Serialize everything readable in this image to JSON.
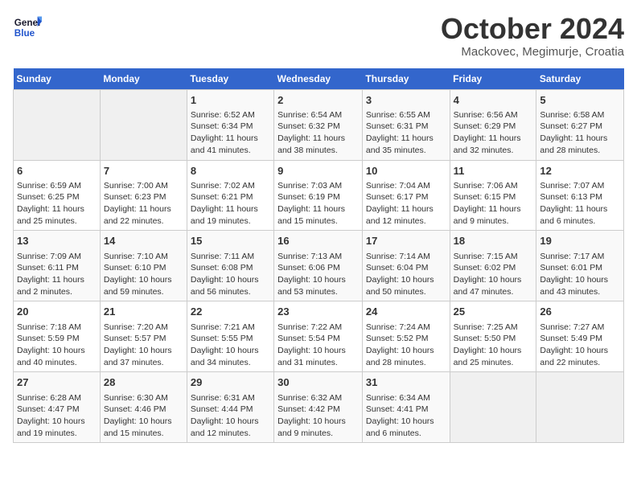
{
  "header": {
    "logo_general": "General",
    "logo_blue": "Blue",
    "month": "October 2024",
    "location": "Mackovec, Megimurje, Croatia"
  },
  "columns": [
    "Sunday",
    "Monday",
    "Tuesday",
    "Wednesday",
    "Thursday",
    "Friday",
    "Saturday"
  ],
  "weeks": [
    [
      {
        "day": "",
        "sunrise": "",
        "sunset": "",
        "daylight": "",
        "empty": true
      },
      {
        "day": "",
        "sunrise": "",
        "sunset": "",
        "daylight": "",
        "empty": true
      },
      {
        "day": "1",
        "sunrise": "Sunrise: 6:52 AM",
        "sunset": "Sunset: 6:34 PM",
        "daylight": "Daylight: 11 hours and 41 minutes."
      },
      {
        "day": "2",
        "sunrise": "Sunrise: 6:54 AM",
        "sunset": "Sunset: 6:32 PM",
        "daylight": "Daylight: 11 hours and 38 minutes."
      },
      {
        "day": "3",
        "sunrise": "Sunrise: 6:55 AM",
        "sunset": "Sunset: 6:31 PM",
        "daylight": "Daylight: 11 hours and 35 minutes."
      },
      {
        "day": "4",
        "sunrise": "Sunrise: 6:56 AM",
        "sunset": "Sunset: 6:29 PM",
        "daylight": "Daylight: 11 hours and 32 minutes."
      },
      {
        "day": "5",
        "sunrise": "Sunrise: 6:58 AM",
        "sunset": "Sunset: 6:27 PM",
        "daylight": "Daylight: 11 hours and 28 minutes."
      }
    ],
    [
      {
        "day": "6",
        "sunrise": "Sunrise: 6:59 AM",
        "sunset": "Sunset: 6:25 PM",
        "daylight": "Daylight: 11 hours and 25 minutes."
      },
      {
        "day": "7",
        "sunrise": "Sunrise: 7:00 AM",
        "sunset": "Sunset: 6:23 PM",
        "daylight": "Daylight: 11 hours and 22 minutes."
      },
      {
        "day": "8",
        "sunrise": "Sunrise: 7:02 AM",
        "sunset": "Sunset: 6:21 PM",
        "daylight": "Daylight: 11 hours and 19 minutes."
      },
      {
        "day": "9",
        "sunrise": "Sunrise: 7:03 AM",
        "sunset": "Sunset: 6:19 PM",
        "daylight": "Daylight: 11 hours and 15 minutes."
      },
      {
        "day": "10",
        "sunrise": "Sunrise: 7:04 AM",
        "sunset": "Sunset: 6:17 PM",
        "daylight": "Daylight: 11 hours and 12 minutes."
      },
      {
        "day": "11",
        "sunrise": "Sunrise: 7:06 AM",
        "sunset": "Sunset: 6:15 PM",
        "daylight": "Daylight: 11 hours and 9 minutes."
      },
      {
        "day": "12",
        "sunrise": "Sunrise: 7:07 AM",
        "sunset": "Sunset: 6:13 PM",
        "daylight": "Daylight: 11 hours and 6 minutes."
      }
    ],
    [
      {
        "day": "13",
        "sunrise": "Sunrise: 7:09 AM",
        "sunset": "Sunset: 6:11 PM",
        "daylight": "Daylight: 11 hours and 2 minutes."
      },
      {
        "day": "14",
        "sunrise": "Sunrise: 7:10 AM",
        "sunset": "Sunset: 6:10 PM",
        "daylight": "Daylight: 10 hours and 59 minutes."
      },
      {
        "day": "15",
        "sunrise": "Sunrise: 7:11 AM",
        "sunset": "Sunset: 6:08 PM",
        "daylight": "Daylight: 10 hours and 56 minutes."
      },
      {
        "day": "16",
        "sunrise": "Sunrise: 7:13 AM",
        "sunset": "Sunset: 6:06 PM",
        "daylight": "Daylight: 10 hours and 53 minutes."
      },
      {
        "day": "17",
        "sunrise": "Sunrise: 7:14 AM",
        "sunset": "Sunset: 6:04 PM",
        "daylight": "Daylight: 10 hours and 50 minutes."
      },
      {
        "day": "18",
        "sunrise": "Sunrise: 7:15 AM",
        "sunset": "Sunset: 6:02 PM",
        "daylight": "Daylight: 10 hours and 47 minutes."
      },
      {
        "day": "19",
        "sunrise": "Sunrise: 7:17 AM",
        "sunset": "Sunset: 6:01 PM",
        "daylight": "Daylight: 10 hours and 43 minutes."
      }
    ],
    [
      {
        "day": "20",
        "sunrise": "Sunrise: 7:18 AM",
        "sunset": "Sunset: 5:59 PM",
        "daylight": "Daylight: 10 hours and 40 minutes."
      },
      {
        "day": "21",
        "sunrise": "Sunrise: 7:20 AM",
        "sunset": "Sunset: 5:57 PM",
        "daylight": "Daylight: 10 hours and 37 minutes."
      },
      {
        "day": "22",
        "sunrise": "Sunrise: 7:21 AM",
        "sunset": "Sunset: 5:55 PM",
        "daylight": "Daylight: 10 hours and 34 minutes."
      },
      {
        "day": "23",
        "sunrise": "Sunrise: 7:22 AM",
        "sunset": "Sunset: 5:54 PM",
        "daylight": "Daylight: 10 hours and 31 minutes."
      },
      {
        "day": "24",
        "sunrise": "Sunrise: 7:24 AM",
        "sunset": "Sunset: 5:52 PM",
        "daylight": "Daylight: 10 hours and 28 minutes."
      },
      {
        "day": "25",
        "sunrise": "Sunrise: 7:25 AM",
        "sunset": "Sunset: 5:50 PM",
        "daylight": "Daylight: 10 hours and 25 minutes."
      },
      {
        "day": "26",
        "sunrise": "Sunrise: 7:27 AM",
        "sunset": "Sunset: 5:49 PM",
        "daylight": "Daylight: 10 hours and 22 minutes."
      }
    ],
    [
      {
        "day": "27",
        "sunrise": "Sunrise: 6:28 AM",
        "sunset": "Sunset: 4:47 PM",
        "daylight": "Daylight: 10 hours and 19 minutes."
      },
      {
        "day": "28",
        "sunrise": "Sunrise: 6:30 AM",
        "sunset": "Sunset: 4:46 PM",
        "daylight": "Daylight: 10 hours and 15 minutes."
      },
      {
        "day": "29",
        "sunrise": "Sunrise: 6:31 AM",
        "sunset": "Sunset: 4:44 PM",
        "daylight": "Daylight: 10 hours and 12 minutes."
      },
      {
        "day": "30",
        "sunrise": "Sunrise: 6:32 AM",
        "sunset": "Sunset: 4:42 PM",
        "daylight": "Daylight: 10 hours and 9 minutes."
      },
      {
        "day": "31",
        "sunrise": "Sunrise: 6:34 AM",
        "sunset": "Sunset: 4:41 PM",
        "daylight": "Daylight: 10 hours and 6 minutes."
      },
      {
        "day": "",
        "sunrise": "",
        "sunset": "",
        "daylight": "",
        "empty": true
      },
      {
        "day": "",
        "sunrise": "",
        "sunset": "",
        "daylight": "",
        "empty": true
      }
    ]
  ]
}
